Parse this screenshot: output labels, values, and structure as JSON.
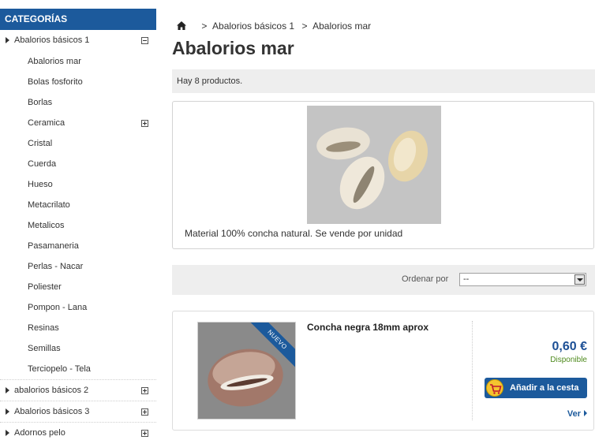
{
  "sidebar": {
    "header": "CATEGORÍAS",
    "expanded_category": {
      "label": "Abalorios básicos 1",
      "toggle": "minus"
    },
    "subcategories": [
      {
        "label": "Abalorios mar",
        "toggle": ""
      },
      {
        "label": "Bolas fosforito",
        "toggle": ""
      },
      {
        "label": "Borlas",
        "toggle": ""
      },
      {
        "label": "Ceramica",
        "toggle": "plus"
      },
      {
        "label": "Cristal",
        "toggle": ""
      },
      {
        "label": "Cuerda",
        "toggle": ""
      },
      {
        "label": "Hueso",
        "toggle": ""
      },
      {
        "label": "Metacrilato",
        "toggle": ""
      },
      {
        "label": "Metalicos",
        "toggle": ""
      },
      {
        "label": "Pasamaneria",
        "toggle": ""
      },
      {
        "label": "Perlas - Nacar",
        "toggle": ""
      },
      {
        "label": "Poliester",
        "toggle": ""
      },
      {
        "label": "Pompon - Lana",
        "toggle": ""
      },
      {
        "label": "Resinas",
        "toggle": ""
      },
      {
        "label": "Semillas",
        "toggle": ""
      },
      {
        "label": "Terciopelo - Tela",
        "toggle": ""
      }
    ],
    "other_categories": [
      {
        "label": "abalorios básicos 2",
        "toggle": "plus"
      },
      {
        "label": "Abalorios básicos 3",
        "toggle": "plus"
      },
      {
        "label": "Adornos pelo",
        "toggle": "plus"
      }
    ]
  },
  "breadcrumb": {
    "home_icon": "home-icon",
    "separator": ">",
    "items": [
      "Abalorios básicos 1",
      "Abalorios mar"
    ]
  },
  "page": {
    "title": "Abalorios mar",
    "product_count": "Hay 8 productos.",
    "description": "Material 100% concha natural. Se vende por unidad"
  },
  "sort": {
    "label": "Ordenar por",
    "selected": "--"
  },
  "product": {
    "badge": "NUEVO",
    "name": "Concha negra 18mm aprox",
    "price": "0,60 €",
    "availability": "Disponible",
    "add_to_cart": "Añadir a la cesta",
    "view": "Ver"
  },
  "colors": {
    "accent": "#1c5a9c",
    "price": "#1c4f95",
    "available": "#4e8a1d",
    "cart_icon": "#f4c430"
  }
}
